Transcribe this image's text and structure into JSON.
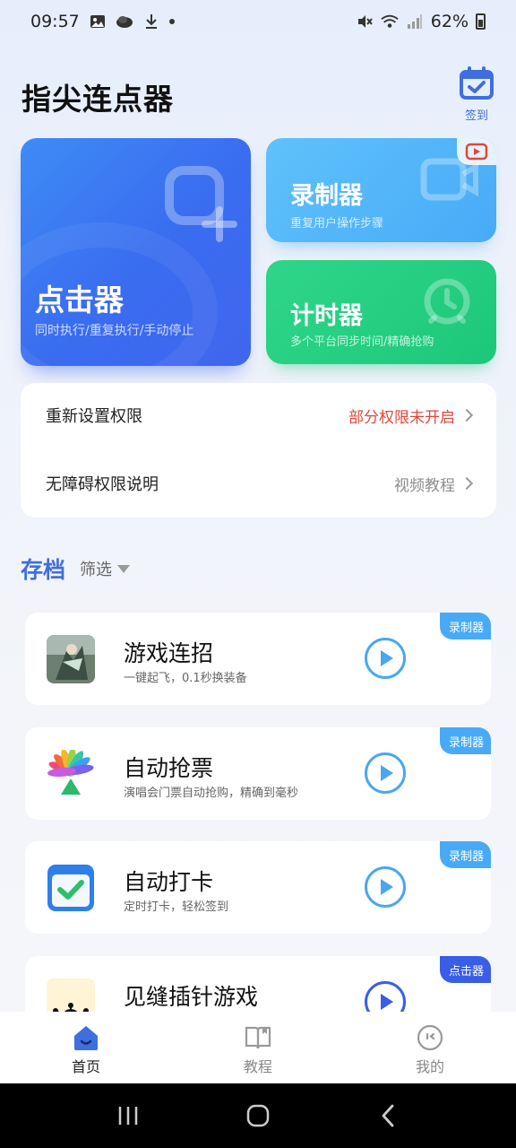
{
  "status_bar": {
    "time": "09:57",
    "battery": "62%"
  },
  "header": {
    "title": "指尖连点器",
    "checkin_label": "签到"
  },
  "features": {
    "clicker": {
      "title": "点击器",
      "subtitle": "同时执行/重复执行/手动停止"
    },
    "recorder": {
      "title": "录制器",
      "subtitle": "重复用户操作步骤"
    },
    "timer": {
      "title": "计时器",
      "subtitle": "多个平台同步时间/精确抢购"
    }
  },
  "permissions": [
    {
      "label": "重新设置权限",
      "status": "部分权限未开启"
    },
    {
      "label": "无障碍权限说明",
      "status": "视频教程"
    }
  ],
  "archive": {
    "title": "存档",
    "filter_label": "筛选"
  },
  "items": [
    {
      "title": "游戏连招",
      "desc": "一键起飞，0.1秒换装备",
      "tag": "录制器"
    },
    {
      "title": "自动抢票",
      "desc": "演唱会门票自动抢购，精确到毫秒",
      "tag": "录制器"
    },
    {
      "title": "自动打卡",
      "desc": "定时打卡，轻松签到",
      "tag": "录制器"
    },
    {
      "title": "见缝插针游戏",
      "desc": "",
      "tag": "点击器"
    }
  ],
  "bottom_nav": [
    {
      "label": "首页",
      "active": true
    },
    {
      "label": "教程",
      "active": false
    },
    {
      "label": "我的",
      "active": false
    }
  ],
  "colors": {
    "accent": "#3f6ee0",
    "warning": "#e2473a",
    "recorder": "#48aaf7",
    "timer": "#1dc77a",
    "clicker": "#3a6cf0"
  }
}
